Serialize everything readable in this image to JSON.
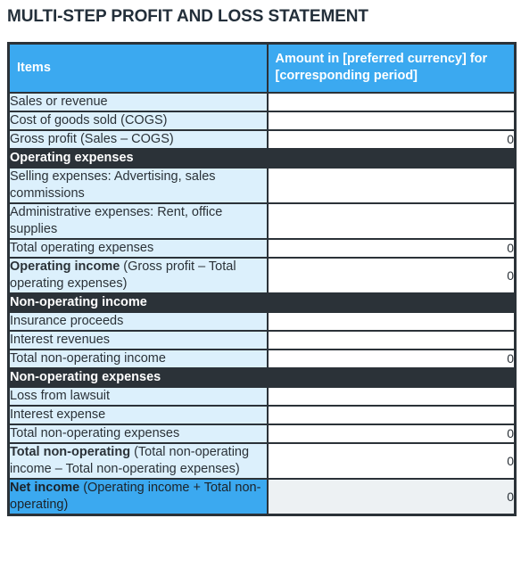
{
  "document": {
    "title": "MULTI-STEP PROFIT AND LOSS STATEMENT"
  },
  "colors": {
    "accent_blue": "#3BA9F0",
    "row_light_blue": "#DCF0FC",
    "section_dark": "#2B3238",
    "net_income_value_bg": "#EDF1F3",
    "text_dark": "#2B3238",
    "border": "#2B3238"
  },
  "table": {
    "columns": [
      {
        "key": "items",
        "label": "Items"
      },
      {
        "key": "amount",
        "label": "Amount in [preferred currency] for [corresponding period]"
      }
    ],
    "rows": [
      {
        "type": "data",
        "label": "Sales or revenue",
        "label_bold": "",
        "value": ""
      },
      {
        "type": "data",
        "label": "Cost of goods sold (COGS)",
        "label_bold": "",
        "value": ""
      },
      {
        "type": "data",
        "label": "Gross profit (Sales – COGS)",
        "label_bold": "",
        "value": "0"
      },
      {
        "type": "section",
        "label": "Operating expenses",
        "label_bold": "",
        "value": ""
      },
      {
        "type": "data",
        "label": "Selling expenses: Advertising, sales commissions",
        "label_bold": "",
        "value": ""
      },
      {
        "type": "data",
        "label": "Administrative expenses: Rent, office supplies",
        "label_bold": "",
        "value": ""
      },
      {
        "type": "data",
        "label": "Total operating expenses",
        "label_bold": "",
        "value": "0"
      },
      {
        "type": "data",
        "label": " (Gross profit – Total operating expenses)",
        "label_bold": "Operating income",
        "value": "0"
      },
      {
        "type": "section",
        "label": "Non-operating income",
        "label_bold": "",
        "value": ""
      },
      {
        "type": "data",
        "label": "Insurance proceeds",
        "label_bold": "",
        "value": ""
      },
      {
        "type": "data",
        "label": "Interest revenues",
        "label_bold": "",
        "value": ""
      },
      {
        "type": "data",
        "label": "Total non-operating income",
        "label_bold": "",
        "value": "0"
      },
      {
        "type": "section",
        "label": "Non-operating expenses",
        "label_bold": "",
        "value": ""
      },
      {
        "type": "data",
        "label": "Loss from lawsuit",
        "label_bold": "",
        "value": ""
      },
      {
        "type": "data",
        "label": "Interest expense",
        "label_bold": "",
        "value": ""
      },
      {
        "type": "data",
        "label": "Total non-operating expenses",
        "label_bold": "",
        "value": "0"
      },
      {
        "type": "data",
        "label": " (Total non-operating income – Total non-operating expenses)",
        "label_bold": "Total non-operating",
        "value": "0"
      },
      {
        "type": "net",
        "label": " (Operating income + Total non-operating)",
        "label_bold": "Net income",
        "value": "0"
      }
    ]
  }
}
